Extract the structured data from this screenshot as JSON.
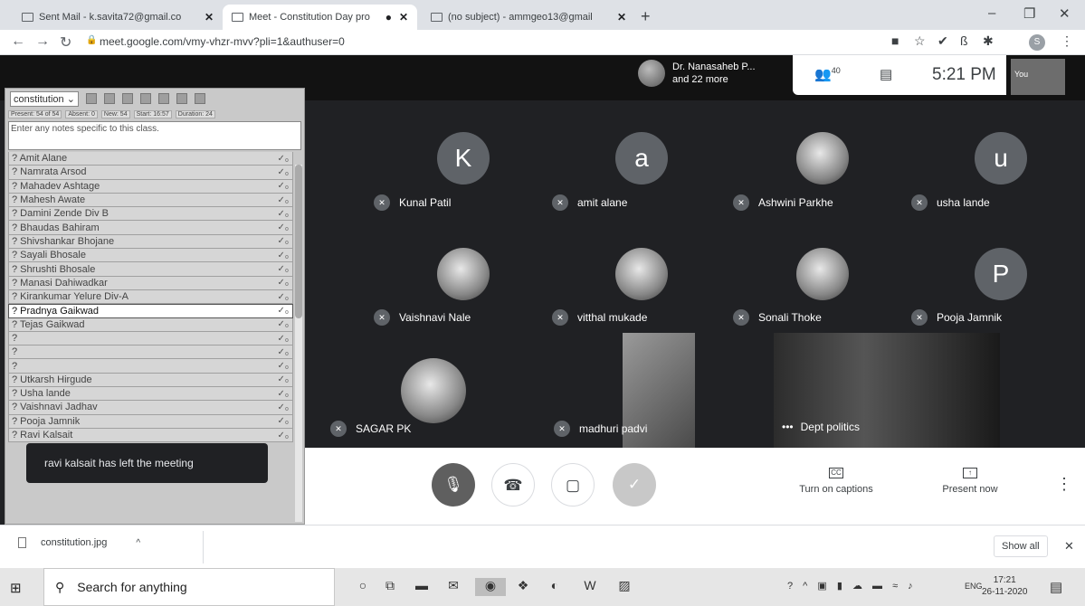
{
  "browser": {
    "tabs": [
      {
        "title": "Sent Mail - k.savita72@gmail.co"
      },
      {
        "title": "Meet - Constitution Day pro"
      },
      {
        "title": "(no subject) - ammgeo13@gmail"
      }
    ],
    "new_tab": "+",
    "url": "meet.google.com/vmy-vhzr-mvv?pli=1&authuser=0",
    "profile_initial": "S"
  },
  "meet": {
    "presenter": {
      "name": "Dr. Nanasaheb P...",
      "more": "and 22 more"
    },
    "participant_count": "40",
    "clock": "5:21 PM",
    "self_label": "You",
    "tiles": [
      {
        "name": "Kunal Patil",
        "initial": "K",
        "photo": false
      },
      {
        "name": "amit alane",
        "initial": "a",
        "photo": false
      },
      {
        "name": "Ashwini Parkhe",
        "initial": "",
        "photo": true
      },
      {
        "name": "usha lande",
        "initial": "u",
        "photo": false
      },
      {
        "name": "Vaishnavi Nale",
        "initial": "",
        "photo": true
      },
      {
        "name": "vitthal mukade",
        "initial": "",
        "photo": true
      },
      {
        "name": "Sonali Thoke",
        "initial": "",
        "photo": true
      },
      {
        "name": "Pooja Jamnik",
        "initial": "P",
        "photo": false
      },
      {
        "name": "SAGAR PK",
        "initial": "",
        "photo": true
      },
      {
        "name": "madhuri padvi",
        "initial": "",
        "photo": false
      },
      {
        "name": "Dept politics",
        "initial": "",
        "photo": false
      }
    ],
    "controls": {
      "captions_label": "Turn on captions",
      "captions_icon": "CC",
      "present_label": "Present now"
    },
    "toast": "ravi kalsait has left the meeting"
  },
  "attendance": {
    "class_select": "constitution",
    "stats": [
      "Present: 54 of 54",
      "Absent: 0",
      "New: 54",
      "Start: 16:57",
      "Duration: 24"
    ],
    "notes_placeholder": "Enter any notes specific to this class.",
    "students": [
      "? Amit Alane",
      "? Namrata Arsod",
      "? Mahadev Ashtage",
      "? Mahesh Awate",
      "? Damini Zende Div B",
      "? Bhaudas Bahiram",
      "? Shivshankar Bhojane",
      "? Sayali Bhosale",
      "? Shrushti Bhosale",
      "? Manasi Dahiwadkar",
      "? Kirankumar Yelure Div-A",
      "? Pradnya Gaikwad",
      "? Tejas Gaikwad",
      "?",
      "?",
      "?",
      "? Utkarsh Hirgude",
      "? Usha lande",
      "? Vaishnavi Jadhav",
      "? Pooja Jamnik",
      "? Ravi Kalsait"
    ],
    "selected_index": 11
  },
  "downloads": {
    "file": "constitution.jpg",
    "show_all": "Show all"
  },
  "taskbar": {
    "search_placeholder": "Search for anything",
    "lang": "ENG",
    "time": "17:21",
    "date": "26-11-2020"
  }
}
